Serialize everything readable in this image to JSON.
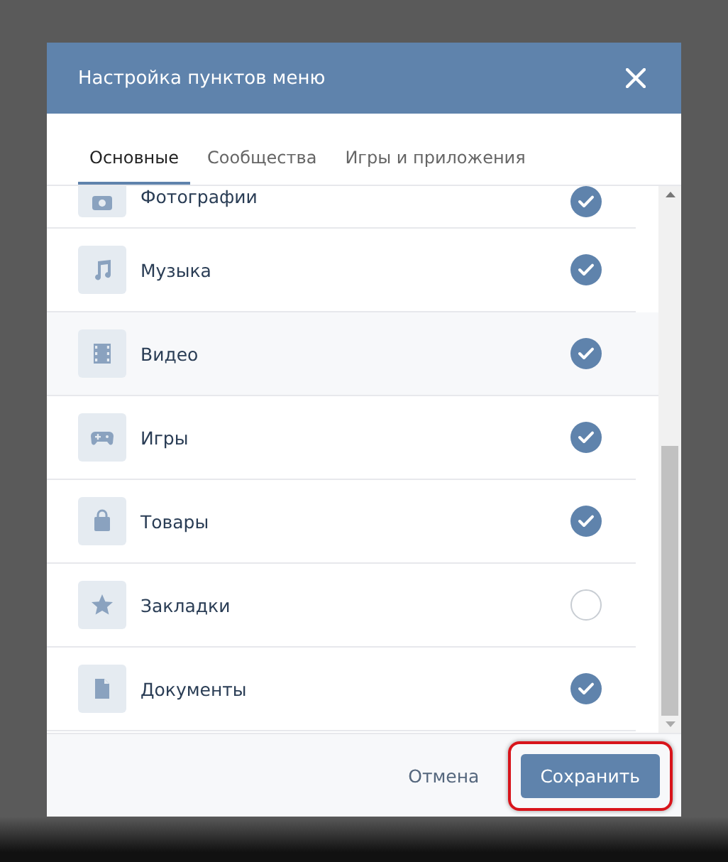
{
  "dialog": {
    "title": "Настройка пунктов меню"
  },
  "tabs": [
    {
      "label": "Основные",
      "selected": true
    },
    {
      "label": "Сообщества",
      "selected": false
    },
    {
      "label": "Игры и приложения",
      "selected": false
    }
  ],
  "items": [
    {
      "label": "Фотографии",
      "kind": "camera",
      "checked": true,
      "partial": true,
      "hovered": false
    },
    {
      "label": "Музыка",
      "kind": "music",
      "checked": true,
      "partial": false,
      "hovered": false
    },
    {
      "label": "Видео",
      "kind": "film",
      "checked": true,
      "partial": false,
      "hovered": true
    },
    {
      "label": "Игры",
      "kind": "gamepad",
      "checked": true,
      "partial": false,
      "hovered": false
    },
    {
      "label": "Товары",
      "kind": "bag",
      "checked": true,
      "partial": false,
      "hovered": false
    },
    {
      "label": "Закладки",
      "kind": "star",
      "checked": false,
      "partial": false,
      "hovered": false
    },
    {
      "label": "Документы",
      "kind": "document",
      "checked": true,
      "partial": false,
      "hovered": false
    }
  ],
  "footer": {
    "cancel": "Отмена",
    "save": {
      "label": "Сохранить",
      "highlighted": true
    }
  }
}
